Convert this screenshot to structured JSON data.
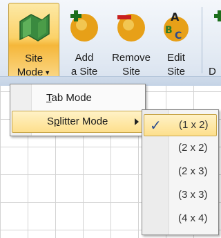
{
  "ribbon": {
    "buttons": [
      {
        "line1": "Site",
        "line2": "Mode",
        "icon": "map-icon"
      },
      {
        "line1": "Add",
        "line2": "a Site",
        "icon": "add-site-icon"
      },
      {
        "line1": "Remove",
        "line2": "Site",
        "icon": "remove-site-icon"
      },
      {
        "line1": "Edit",
        "line2": "Site",
        "icon": "edit-site-icon"
      },
      {
        "line2": "D",
        "icon": "partial-icon"
      }
    ]
  },
  "menu": {
    "items": [
      {
        "label_key": "T",
        "label_rest": "ab Mode"
      },
      {
        "label_pre": "S",
        "label_key": "p",
        "label_rest": "litter Mode"
      }
    ]
  },
  "submenu": {
    "checked_index": 0,
    "items": [
      "(1 x 2)",
      "(2 x 2)",
      "(2 x 3)",
      "(3 x 3)",
      "(4 x 4)"
    ]
  },
  "colors": {
    "highlight": "#fddf8c",
    "check": "#2a4b8d"
  }
}
